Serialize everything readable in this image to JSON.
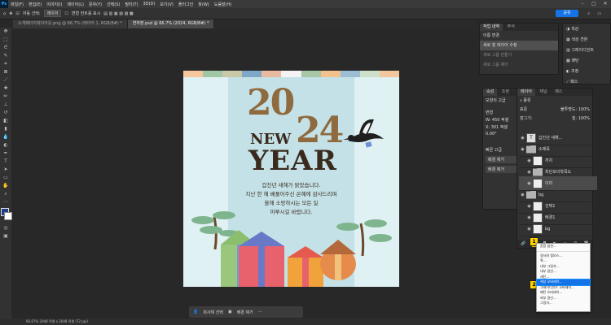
{
  "app": {
    "logo": "Ps"
  },
  "menu": [
    "파일(F)",
    "편집(E)",
    "이미지(I)",
    "레이어(L)",
    "문자(Y)",
    "선택(S)",
    "필터(T)",
    "3D(D)",
    "보기(V)",
    "플러그인",
    "창(W)",
    "도움말(H)"
  ],
  "options": {
    "auto_select": "자동 선택:",
    "target": "레이어",
    "show_transform": "변형 컨트롤 표시",
    "share": "공유"
  },
  "tabs": [
    {
      "label": "소개페이지레이아웃.png @ 66.7% (레이어 1, RGB/8#) *"
    },
    {
      "label": "연하장.psd @ 66.7% (2024, RGB/8#) *"
    }
  ],
  "canvas": {
    "stripe_colors": [
      "#f6c79c",
      "#9fc7a6",
      "#c9c9a8",
      "#7fa7c7",
      "#e9b9a0",
      "#f3f3f3",
      "#a6c6a6",
      "#f2c18e",
      "#9dbdd4",
      "#cde0c9",
      "#f2c79d"
    ],
    "year_top": "20",
    "year_bottom": "24",
    "new": "NEW",
    "year_word": "YEAR",
    "message": [
      "갑진년 새해가 밝았습니다.",
      "지난 한 해 베풀어주신 은혜에 감사드리며",
      "올해 소망하시는 모든 일",
      "이루시길 바랍니다."
    ],
    "accent": "#8f6a3f",
    "dark": "#3a2a1e"
  },
  "taskbar": {
    "select_subject": "피사체 선택",
    "remove_bg": "배경 제거"
  },
  "status": "66.67%   2048 픽셀 x 2048 픽셀 (72 ppi)",
  "history": {
    "tabs": [
      "작업 내역",
      "주석"
    ],
    "items": [
      "이름 변경",
      "새로 칠 레이어 수정",
      "새로 그룹 만들기",
      "새로 그룹 제어"
    ]
  },
  "right_icons": [
    "색상",
    "색상 견본",
    "그레이디언트",
    "패턴",
    "조정",
    "패스"
  ],
  "properties": {
    "tabs": [
      "속성",
      "조정",
      "라이브"
    ],
    "subtitle": "모양의 고급",
    "transform_label": "변형",
    "w": "W: 450 픽셀",
    "x": "X: 301 픽셀",
    "angle": "0.00°",
    "bg_label": "빠른 고급",
    "misc": [
      "배경 제거",
      "배경 제거"
    ]
  },
  "layers": {
    "tabs": [
      "레이어",
      "채널",
      "패스"
    ],
    "kind": "종류",
    "blend": "표준",
    "opacity_label": "불투명도:",
    "opacity": "100%",
    "lock_label": "잠그기:",
    "fill_label": "칠:",
    "fill": "100%",
    "items": [
      {
        "name": "갑진년 새해...",
        "kind": "text"
      },
      {
        "name": "소제목",
        "kind": "folder"
      },
      {
        "name": "까치",
        "kind": "layer"
      },
      {
        "name": "최단모의학목도",
        "kind": "folder"
      },
      {
        "name": "이미",
        "kind": "layer"
      },
      {
        "name": "bg",
        "kind": "folder"
      },
      {
        "name": "선택1",
        "kind": "layer"
      },
      {
        "name": "배경1",
        "kind": "layer"
      },
      {
        "name": "bg",
        "kind": "layer"
      }
    ]
  },
  "context_menu": {
    "items": [
      "혼합 옵션...",
      "경사와 엠보스...",
      "획...",
      "내부 그림자...",
      "내부 광선...",
      "새틴...",
      "색상 오버레이...",
      "그레이디언트 오버레이...",
      "패턴 오버레이...",
      "외부 광선...",
      "그림자..."
    ],
    "highlighted_index": 6
  },
  "steps": [
    "1",
    "2"
  ]
}
